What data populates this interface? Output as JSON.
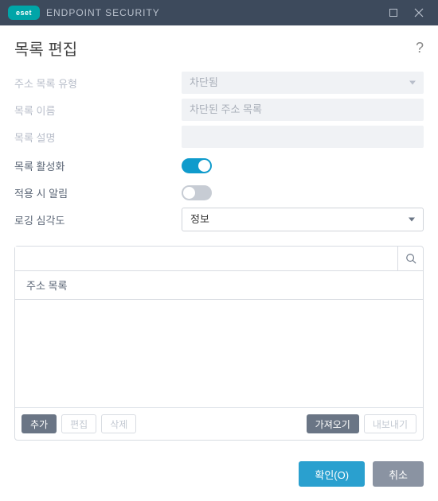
{
  "titlebar": {
    "logo": "eset",
    "app": "ENDPOINT SECURITY"
  },
  "page_title": "목록 편집",
  "help_glyph": "?",
  "fields": {
    "type_label": "주소 목록 유형",
    "type_value": "차단됨",
    "name_label": "목록 이름",
    "name_value": "차단된 주소 목록",
    "desc_label": "목록 설명",
    "activate_label": "목록 활성화",
    "notify_label": "적용 시 알림",
    "severity_label": "로깅 심각도",
    "severity_value": "정보"
  },
  "toggles": {
    "activate": true,
    "notify": false
  },
  "list": {
    "header": "주소 목록",
    "search_placeholder": "",
    "actions": {
      "add": "추가",
      "edit": "편집",
      "delete": "삭제",
      "import": "가져오기",
      "export": "내보내기"
    }
  },
  "footer": {
    "ok": "확인(O)",
    "cancel": "취소"
  }
}
